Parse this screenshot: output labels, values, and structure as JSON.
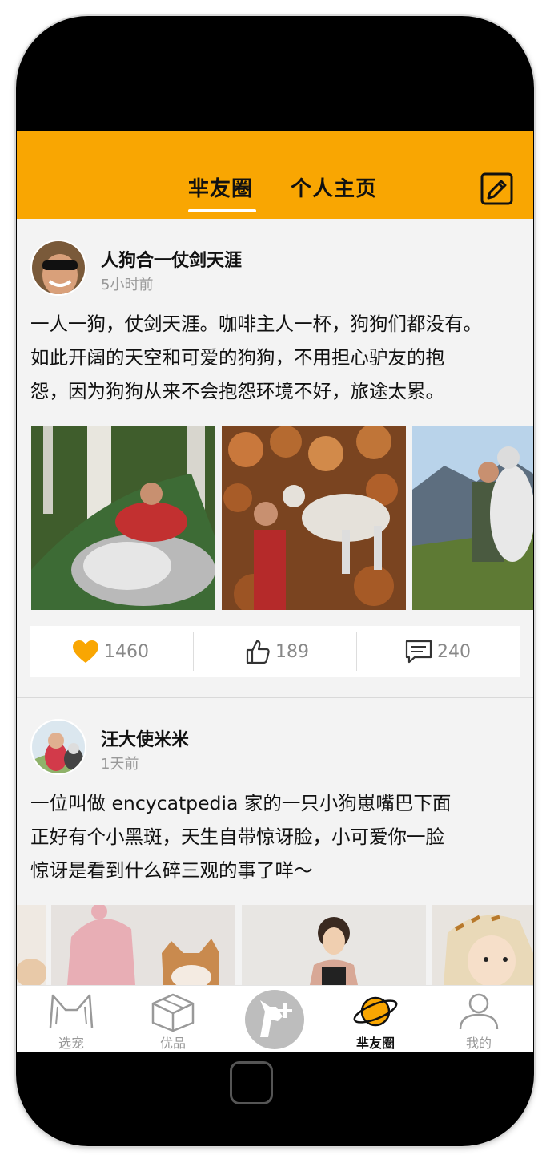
{
  "header": {
    "tabs": [
      {
        "label": "芈友圈",
        "active": true
      },
      {
        "label": "个人主页",
        "active": false
      }
    ],
    "edit_icon": "edit-icon",
    "bg_color": "#f9a602"
  },
  "posts": [
    {
      "username": "人狗合一仗剑天涯",
      "time": "5小时前",
      "text": "一人一狗，仗剑天涯。咖啡主人一杯，狗狗们都没有。\n如此开阔的天空和可爱的狗狗，不用担心驴友的抱\n怨，因为狗狗从来不会抱怨环境不好，旅途太累。",
      "likes": "1460",
      "thumbs": "189",
      "comments": "240"
    },
    {
      "username": "汪大使米米",
      "time": "1天前",
      "text": "一位叫做 encycatpedia 家的一只小狗崽嘴巴下面\n正好有个小黑斑，天生自带惊讶脸，小可爱你一脸\n惊讶是看到什么碎三观的事了咩～"
    }
  ],
  "nav": {
    "items": [
      {
        "label": "选宠",
        "icon": "cat-ears-icon"
      },
      {
        "label": "优品",
        "icon": "box-icon"
      },
      {
        "label": "",
        "icon": "dog-plus-icon"
      },
      {
        "label": "芈友圈",
        "icon": "planet-icon",
        "active": true
      },
      {
        "label": "我的",
        "icon": "user-icon"
      }
    ]
  },
  "colors": {
    "accent": "#f9a602",
    "like": "#f9a602"
  }
}
